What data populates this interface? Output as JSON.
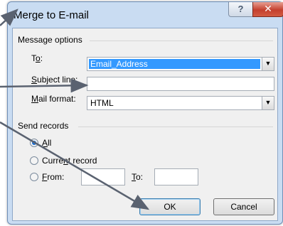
{
  "dialog": {
    "title": "Merge to E-mail",
    "help_glyph": "?",
    "close_glyph": "✕"
  },
  "message_options": {
    "section_label": "Message options",
    "to_label_pre": "T",
    "to_label_u": "o",
    "to_label_post": ":",
    "to_value": "Email_Address",
    "subject_label_pre": "",
    "subject_label_u": "S",
    "subject_label_post": "ubject line:",
    "subject_value": "",
    "format_label_u": "M",
    "format_label_post": "ail format:",
    "format_value": "HTML"
  },
  "send_records": {
    "section_label": "Send records",
    "all_u": "A",
    "all_post": "ll",
    "current_pre": "Curre",
    "current_u": "n",
    "current_post": "t record",
    "from_u": "F",
    "from_post": "rom:",
    "from_value": "",
    "to_u": "T",
    "to_post": "o:",
    "to_value": "",
    "selected": "All"
  },
  "buttons": {
    "ok": "OK",
    "cancel": "Cancel"
  },
  "dropdown_glyph": "▼",
  "colors": {
    "arrow": "#5a6270",
    "selection": "#3399ff",
    "close": "#c4402e"
  }
}
